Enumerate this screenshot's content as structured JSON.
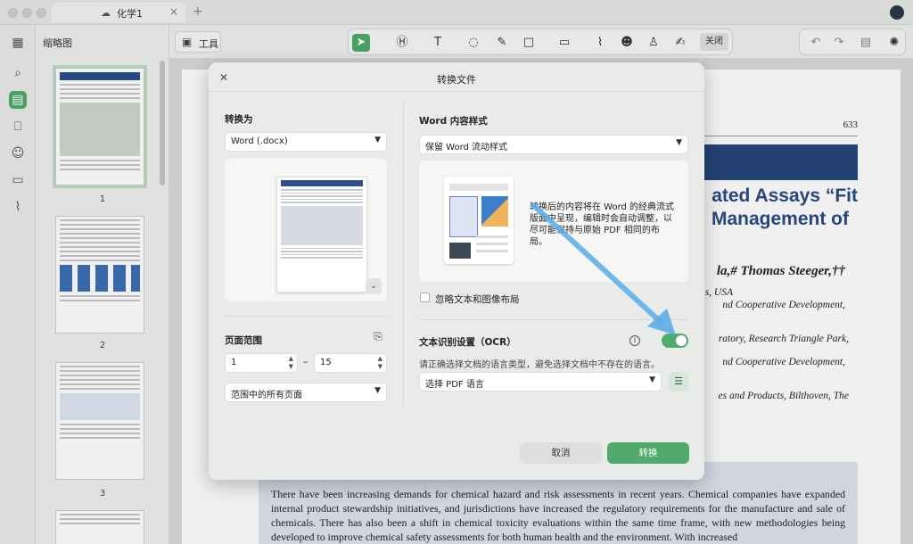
{
  "tab": {
    "title": "化学1"
  },
  "toolbar": {
    "tools_label": "工具",
    "close_label": "关闭"
  },
  "thumbnails": {
    "title": "缩略图",
    "pages": [
      "1",
      "2",
      "3"
    ]
  },
  "document": {
    "page_number": "633",
    "heading_line1": "ated Assays “Fit",
    "heading_line2": "Management of",
    "authors": "la,# Thomas Steeger,††",
    "affiliations": [
      "s, USA",
      "nd Cooperative Development,",
      "ratory, Research Triangle Park,",
      "nd Cooperative Development,",
      "es and Products, Bilthoven, The"
    ],
    "abstract": "There have been increasing demands for chemical hazard and risk assessments in recent years. Chemical companies have expanded internal product stewardship initiatives, and jurisdictions have increased the regulatory requirements for the manufacture and sale of chemicals. There has also been a shift in chemical toxicity evaluations within the same time frame, with new methodologies being developed to improve chemical safety assessments for both human health and the environment. With increased"
  },
  "dialog": {
    "title": "转换文件",
    "convert_to_label": "转换为",
    "convert_to_value": "Word (.docx)",
    "page_range_label": "页面范围",
    "range_from": "1",
    "range_dash": "–",
    "range_to": "15",
    "range_scope": "范围中的所有页面",
    "word_style_label": "Word 内容样式",
    "word_style_value": "保留 Word 流动样式",
    "word_style_desc": "转换后的内容将在 Word 的经典流式版面中呈现，编辑时会自动调整，以尽可能保持与原始 PDF 相同的布局。",
    "ignore_layout_label": "忽略文本和图像布局",
    "ocr_label": "文本识别设置（OCR）",
    "ocr_enabled": true,
    "ocr_hint": "请正确选择文档的语言类型，避免选择文档中不存在的语言。",
    "ocr_language": "选择 PDF 语言",
    "cancel_label": "取消",
    "convert_label": "转换"
  },
  "colors": {
    "accent": "#4faa6b",
    "arrow": "#5aaee8",
    "heading": "#2a4a86"
  }
}
